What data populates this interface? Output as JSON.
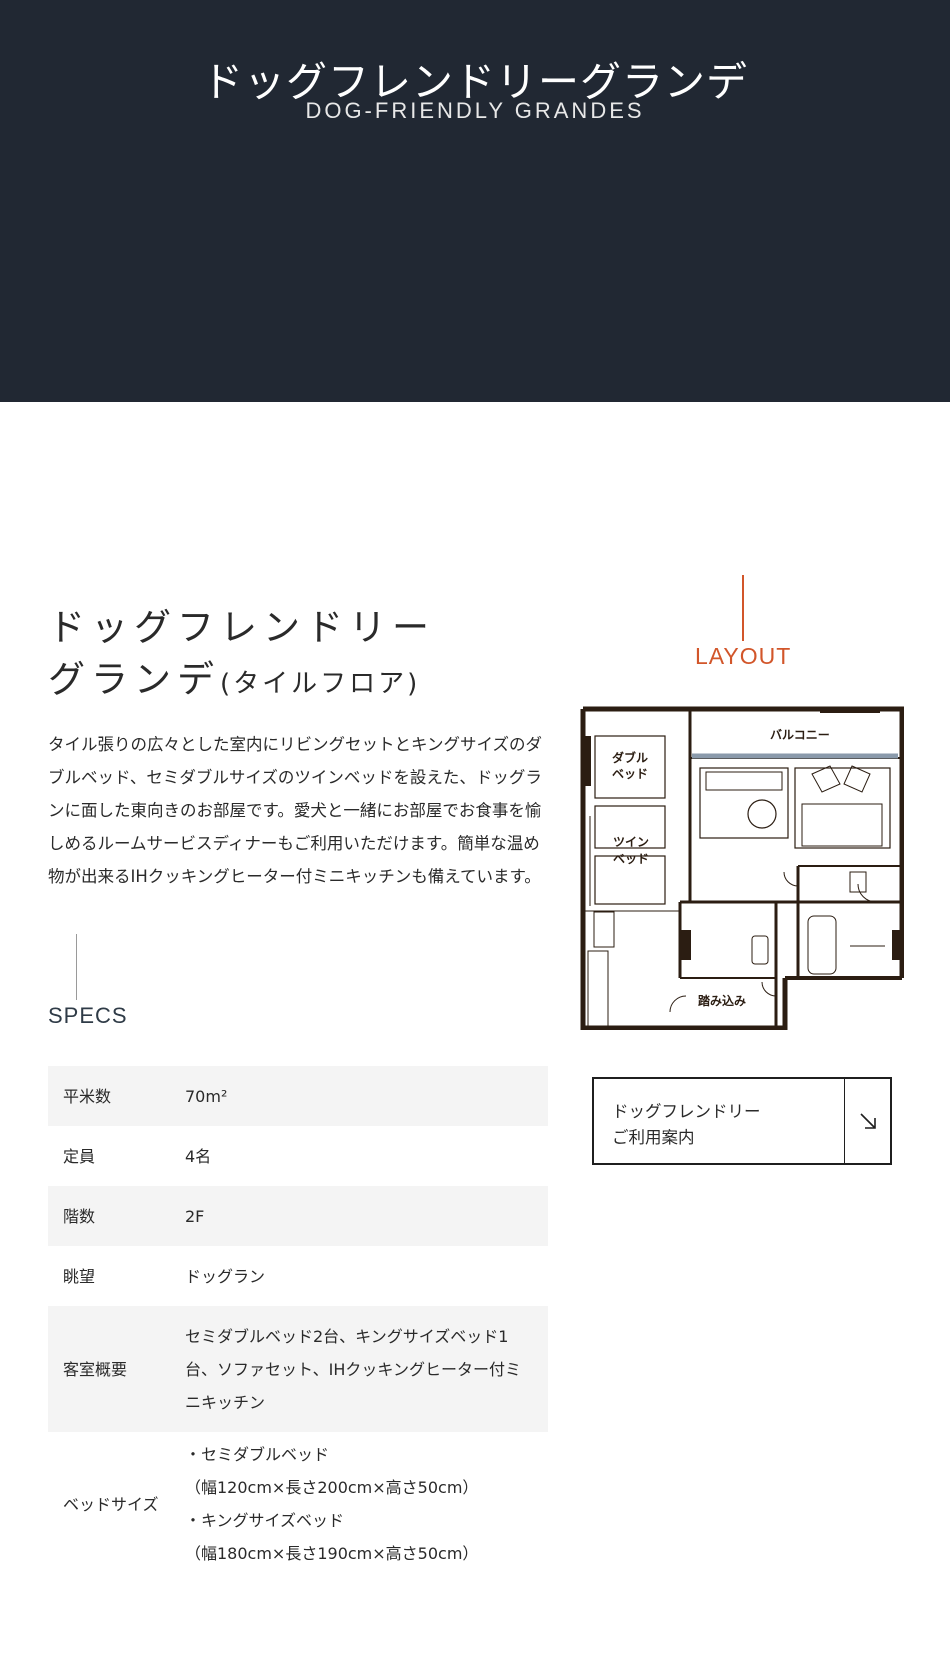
{
  "hero": {
    "title": "ドッグフレンドリーグランデ",
    "subtitle": "DOG-FRIENDLY  GRANDES",
    "background": "#212833"
  },
  "room": {
    "title_line1": "ドッグフレンドリー",
    "title_line2": "グランデ",
    "title_suffix": "(タイルフロア)",
    "description": "タイル張りの広々とした室内にリビングセットとキングサイズのダブルベッド、セミダブルサイズのツインベッドを設えた、ドッグランに面した東向きのお部屋です。愛犬と一緒にお部屋でお食事を愉しめるルームサービスディナーもご利用いただけます。簡単な温め物が出来るIHクッキングヒーター付ミニキッチンも備えています。"
  },
  "specs": {
    "label": "SPECS",
    "rows": [
      {
        "key": "平米数",
        "value": "70m²"
      },
      {
        "key": "定員",
        "value": "4名"
      },
      {
        "key": "階数",
        "value": "2F"
      },
      {
        "key": "眺望",
        "value": "ドッグラン"
      },
      {
        "key": "客室概要",
        "value": "セミダブルベッド2台、キングサイズベッド1台、ソファセット、IHクッキングヒーター付ミニキッチン"
      },
      {
        "key": "ベッドサイズ",
        "value_lines": [
          "・セミダブルベッド",
          "（幅120cm×長さ200cm×高さ50cm）",
          "・キングサイズベッド",
          "（幅180cm×長さ190cm×高さ50cm）"
        ]
      }
    ]
  },
  "layout": {
    "label": "LAYOUT",
    "accent_color": "#d2562a",
    "plan_labels": {
      "balcony": "バルコニー",
      "double_bed": [
        "ダブル",
        "ベッド"
      ],
      "twin_bed": [
        "ツイン",
        "ベッド"
      ],
      "entrance": "踏み込み"
    }
  },
  "guide_button": {
    "line1": "ドッグフレンドリー",
    "line2": "ご利用案内",
    "icon": "arrow-down-right-icon"
  }
}
